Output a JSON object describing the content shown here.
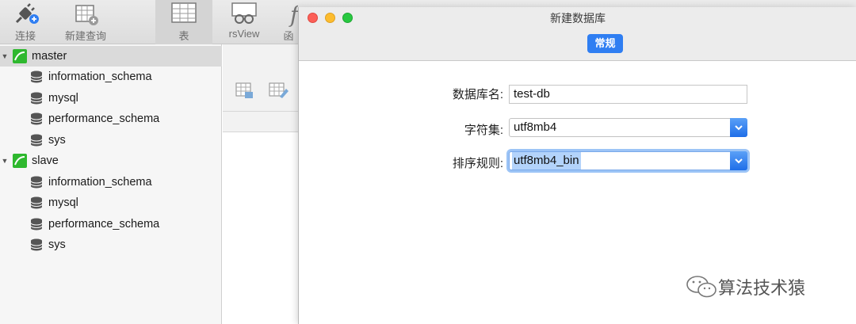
{
  "toolbar": {
    "connect_label": "连接",
    "new_query_label": "新建查询",
    "table_label": "表",
    "view_label": "rsView",
    "function_label": "函"
  },
  "sidebar": {
    "connections": [
      {
        "name": "master",
        "expanded": true,
        "databases": [
          "information_schema",
          "mysql",
          "performance_schema",
          "sys"
        ]
      },
      {
        "name": "slave",
        "expanded": true,
        "databases": [
          "information_schema",
          "mysql",
          "performance_schema",
          "sys"
        ]
      }
    ]
  },
  "dialog": {
    "title": "新建数据库",
    "tab_label": "常规",
    "fields": {
      "db_name_label": "数据库名:",
      "db_name_value": "test-db",
      "charset_label": "字符集:",
      "charset_value": "utf8mb4",
      "collation_label": "排序规则:",
      "collation_value": "utf8mb4_bin"
    }
  },
  "watermark": {
    "text": "算法技术猿"
  },
  "colors": {
    "accent": "#2f7ef2",
    "connection_icon": "#2eb82e",
    "close": "#fc5f57",
    "minimize": "#fdbc2e",
    "zoom": "#28c840"
  }
}
